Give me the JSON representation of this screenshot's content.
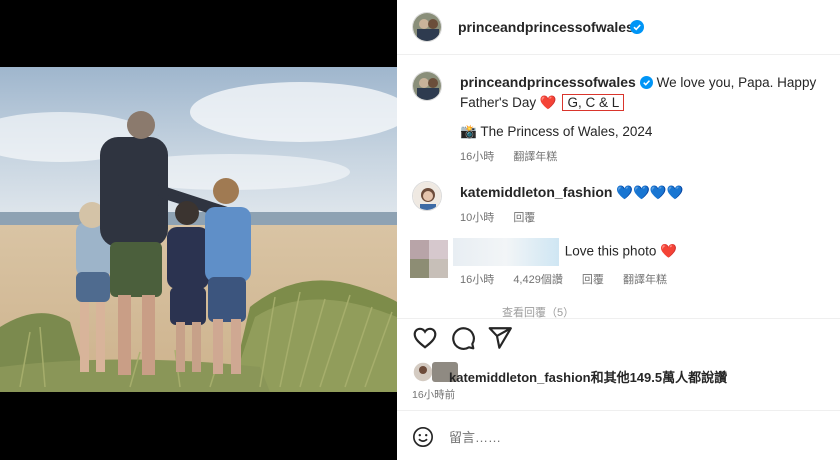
{
  "post": {
    "author": "princeandprincessofwales",
    "verified": true
  },
  "caption": {
    "username": "princeandprincessofwales",
    "text": "We love you, Papa. Happy Father's Day",
    "heart": "❤️",
    "signoff": "G, C & L",
    "camera_emoji": "📸",
    "credit": "The Princess of Wales, 2024",
    "time": "16小時",
    "translate": "翻譯年糕"
  },
  "comments": [
    {
      "username": "katemiddleton_fashion",
      "text": "💙💙💙💙",
      "time": "10小時",
      "reply": "回覆"
    },
    {
      "username": "",
      "text": "Love this photo",
      "heart": "❤️",
      "time": "16小時",
      "likes": "4,429個讚",
      "reply": "回覆",
      "translate": "翻譯年糕"
    }
  ],
  "view_replies": "查看回覆（5）",
  "likes": {
    "user": "katemiddleton_fashion",
    "suffix": "和其他149.5萬人都說讚",
    "time": "16小時前"
  },
  "comment_input": {
    "placeholder": "留言……"
  },
  "icons": {
    "like": "heart-icon",
    "comment": "comment-icon",
    "share": "share-icon",
    "emoji": "emoji-icon",
    "verified": "verified-badge-icon"
  },
  "colors": {
    "verified_blue": "#0095f6",
    "highlight_red": "#d9352c",
    "muted": "#737373"
  }
}
